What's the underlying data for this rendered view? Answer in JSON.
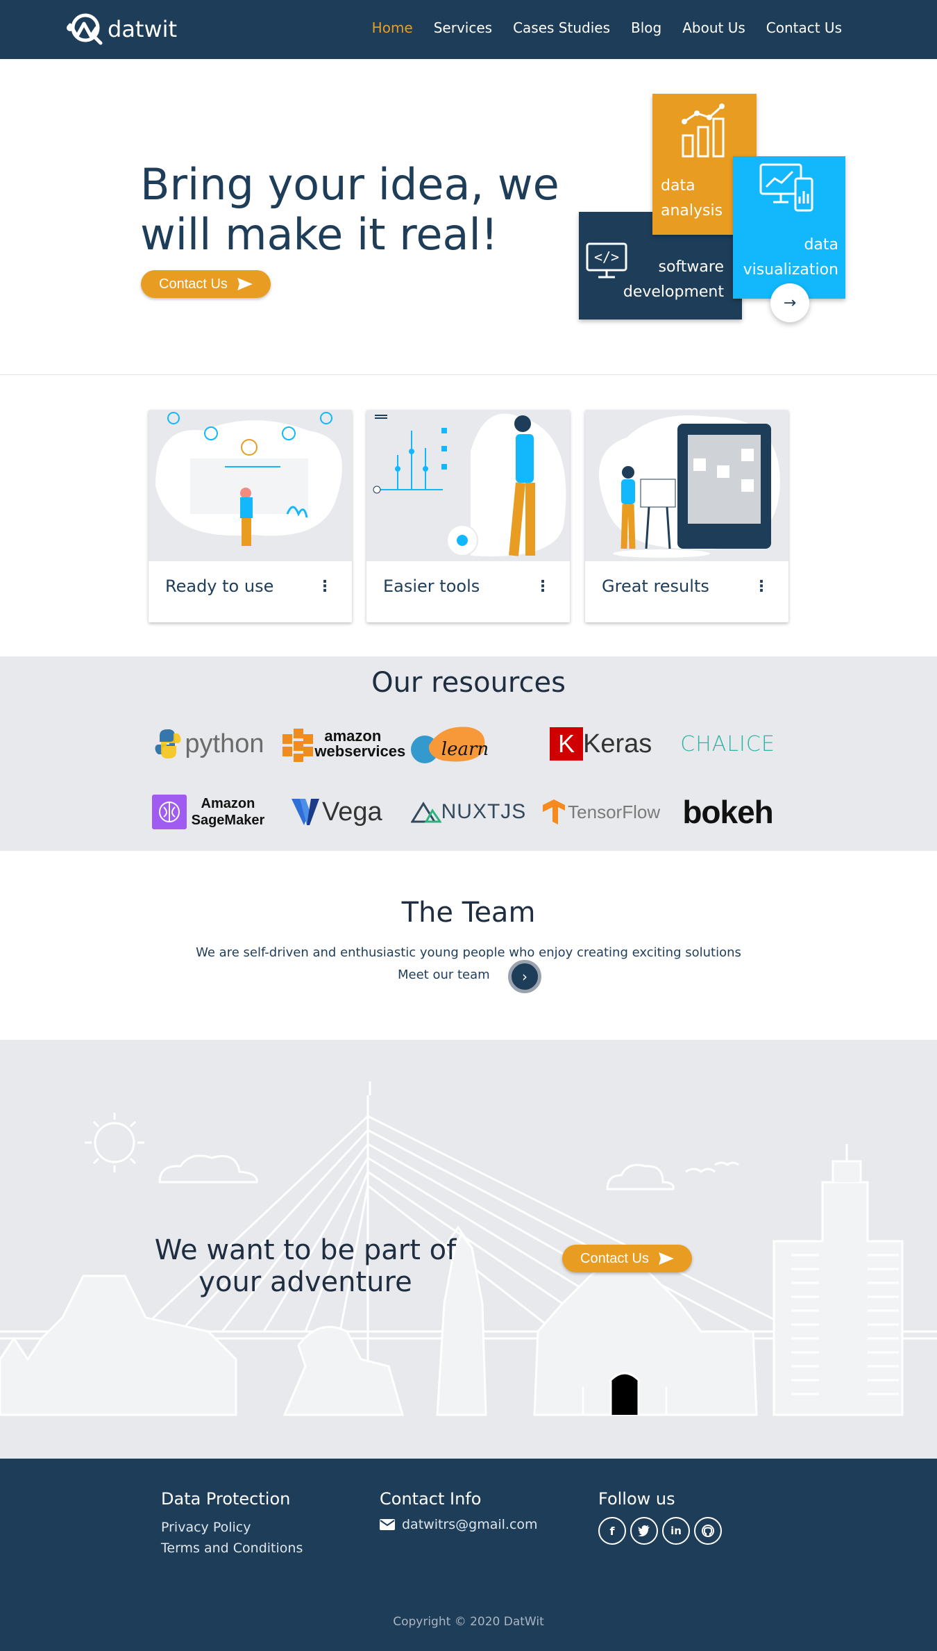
{
  "nav": {
    "brand": "datwit",
    "links": [
      {
        "label": "Home",
        "active": true
      },
      {
        "label": "Services",
        "active": false
      },
      {
        "label": "Cases Studies",
        "active": false
      },
      {
        "label": "Blog",
        "active": false
      },
      {
        "label": "About Us",
        "active": false
      },
      {
        "label": "Contact Us",
        "active": false
      }
    ]
  },
  "hero": {
    "title": "Bring your idea, we will make it real!",
    "cta_label": "Contact Us",
    "tiles": {
      "analysis": "data analysis",
      "software": "software development",
      "visualization": "data visualization"
    }
  },
  "cards": [
    {
      "title": "Ready to use"
    },
    {
      "title": "Easier tools"
    },
    {
      "title": "Great results"
    }
  ],
  "resources": {
    "title": "Our resources",
    "logos": [
      "python",
      "amazon webservices",
      "learn",
      "Keras",
      "CHALICE",
      "Amazon SageMaker",
      "Vega",
      "NUXTJS",
      "TensorFlow",
      "bokeh"
    ]
  },
  "team": {
    "title": "The Team",
    "subtitle": "We are self-driven and enthusiastic young people who enjoy creating exciting solutions",
    "meet_label": "Meet our team"
  },
  "adventure": {
    "title": "We want to be part of your adventure",
    "cta_label": "Contact Us"
  },
  "footer": {
    "protection": {
      "title": "Data Protection",
      "links": [
        "Privacy Policy",
        "Terms and Conditions"
      ]
    },
    "contact": {
      "title": "Contact Info",
      "email": "datwitrs@gmail.com"
    },
    "follow": {
      "title": "Follow us",
      "icons": [
        "facebook-icon",
        "twitter-icon",
        "linkedin-icon",
        "github-icon"
      ]
    },
    "copyright": "Copyright © 2020 DatWit"
  },
  "colors": {
    "navy": "#1e3d59",
    "orange": "#e89d22",
    "cyan": "#12b8fb",
    "light_gray": "#e7e9ec"
  }
}
